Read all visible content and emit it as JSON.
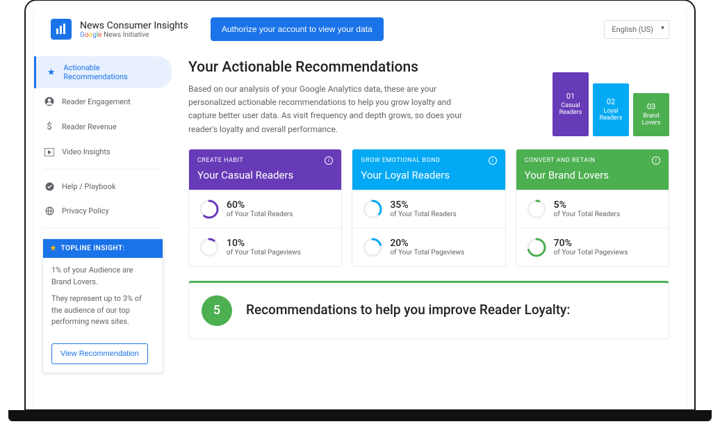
{
  "header": {
    "title": "News Consumer Insights",
    "subtitle_suffix": " News Initiative",
    "auth_button": "Authorize your account to view your data",
    "language": "English (US)"
  },
  "sidebar": {
    "items": [
      {
        "label": "Actionable Recommendations"
      },
      {
        "label": "Reader Engagement"
      },
      {
        "label": "Reader Revenue"
      },
      {
        "label": "Video Insights"
      },
      {
        "label": "Help / Playbook"
      },
      {
        "label": "Privacy Policy"
      }
    ]
  },
  "insight": {
    "heading": "TOPLINE INSIGHT:",
    "line1": "1% of your Audience are Brand Lovers.",
    "line2": "They represent up to 3% of the audience of our top performing news sites.",
    "button": "View Recommendation"
  },
  "hero": {
    "title": "Your Actionable Recommendations",
    "body": "Based on our analysis of your Google Analytics data, these are your personalized actionable recommendations to help you grow loyalty and capture better user data. As visit frequency and depth grows, so does your reader's loyalty and overall performance."
  },
  "funnel": [
    {
      "num": "01",
      "label": "Casual Readers"
    },
    {
      "num": "02",
      "label": "Loyal Readers"
    },
    {
      "num": "03",
      "label": "Brand Lovers"
    }
  ],
  "segments": [
    {
      "tag": "CREATE HABIT",
      "title": "Your Casual Readers",
      "color": "#673ab7",
      "metrics": [
        {
          "value": "60%",
          "sub": "of Your Total Readers",
          "pct": 60
        },
        {
          "value": "10%",
          "sub": "of Your Total Pageviews",
          "pct": 10
        }
      ]
    },
    {
      "tag": "GROW EMOTIONAL BOND",
      "title": "Your Loyal Readers",
      "color": "#03a9f4",
      "metrics": [
        {
          "value": "35%",
          "sub": "of Your Total Readers",
          "pct": 35
        },
        {
          "value": "20%",
          "sub": "of Your Total Pageviews",
          "pct": 20
        }
      ]
    },
    {
      "tag": "CONVERT AND RETAIN",
      "title": "Your Brand Lovers",
      "color": "#4caf50",
      "metrics": [
        {
          "value": "5%",
          "sub": "of Your Total Readers",
          "pct": 5
        },
        {
          "value": "70%",
          "sub": "of Your Total Pageviews",
          "pct": 70
        }
      ]
    }
  ],
  "reco": {
    "count": "5",
    "title": "Recommendations to help you improve Reader Loyalty:"
  }
}
